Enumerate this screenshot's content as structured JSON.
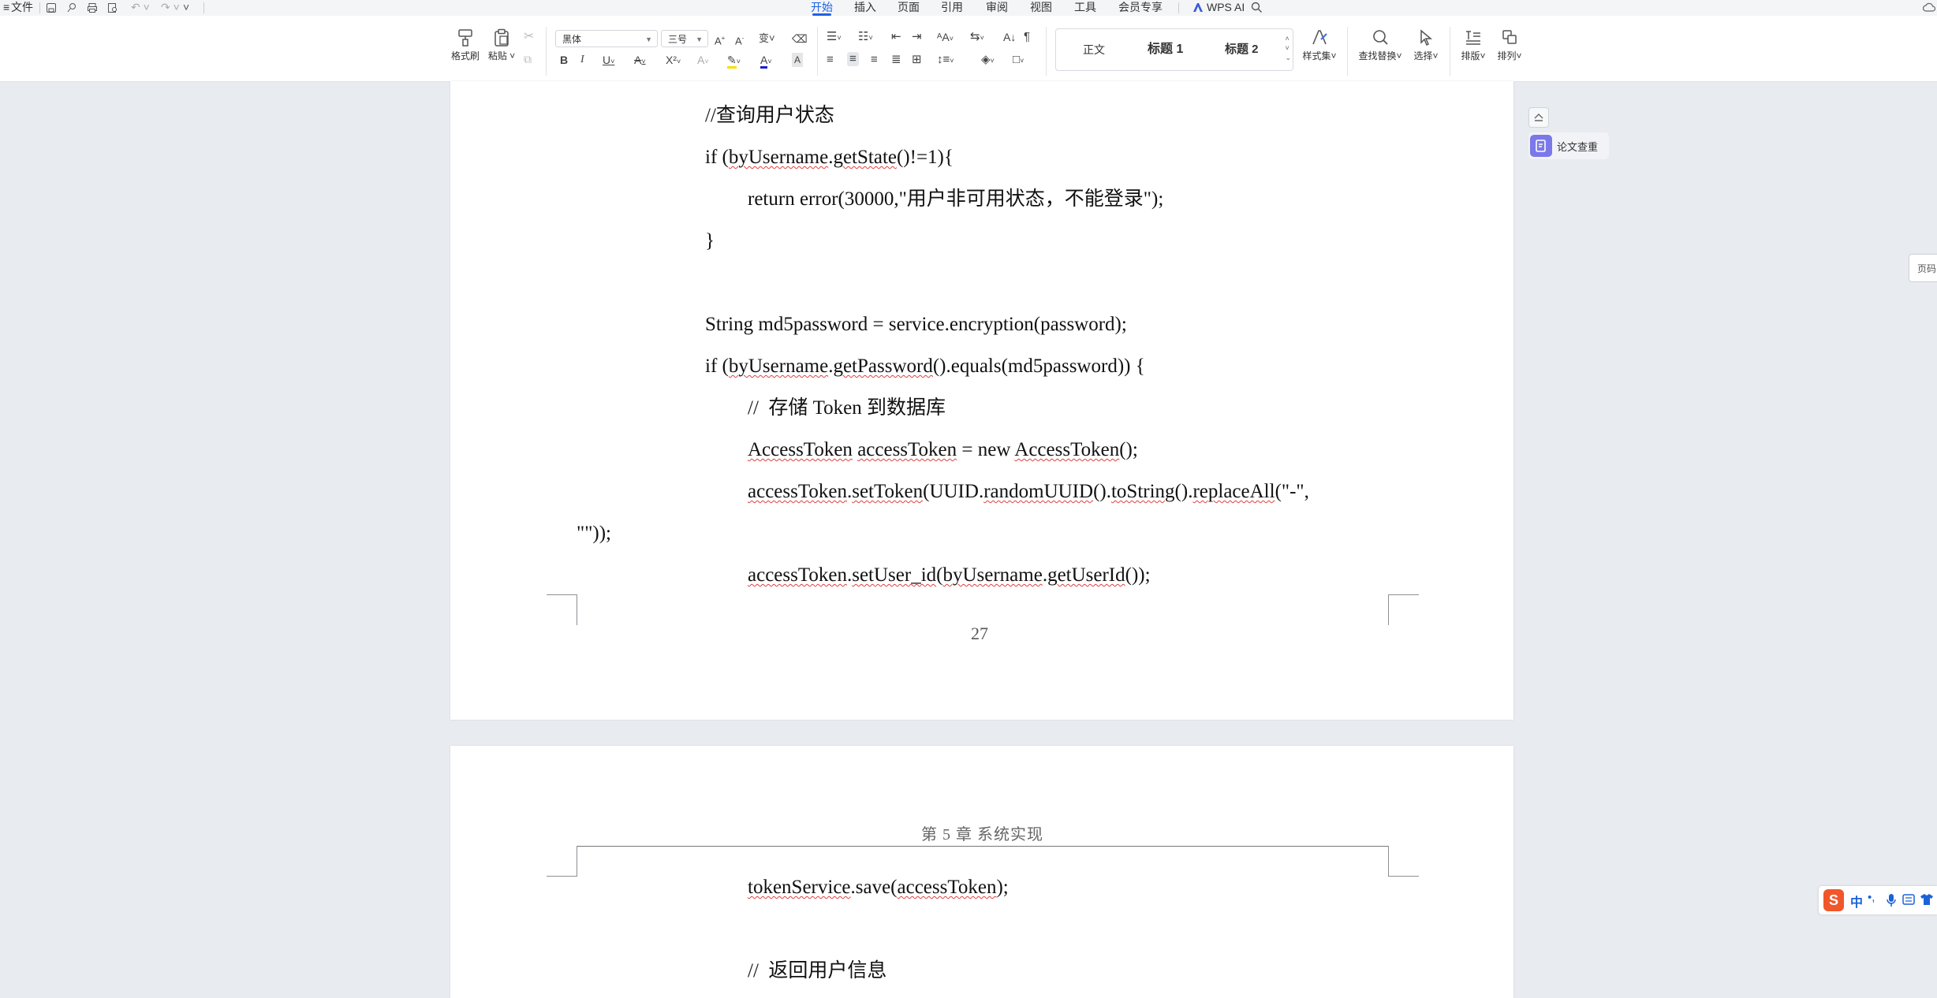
{
  "titlebar": {
    "file_label": "文件",
    "tabs": [
      "开始",
      "插入",
      "页面",
      "引用",
      "审阅",
      "视图",
      "工具",
      "会员专享"
    ],
    "active_tab": "开始",
    "wps_ai_label": "WPS AI"
  },
  "ribbon": {
    "format_painter_label": "格式刷",
    "paste_label": "粘贴",
    "font_name": "黑体",
    "font_size": "三号",
    "styles": [
      "正文",
      "标题 1",
      "标题 2"
    ],
    "style_set_label": "样式集",
    "find_replace_label": "查找替换",
    "select_label": "选择",
    "layout_label": "排版",
    "arrange_label": "排列"
  },
  "side": {
    "check_label": "论文查重",
    "page_tab_label": "页码"
  },
  "page1": {
    "lines": [
      "//查询用户状态",
      "if (byUsername.getState()!=1){",
      "return error(30000,\"用户非可用状态，不能登录\");",
      "}",
      "String md5password = service.encryption(password);",
      "if (byUsername.getPassword().equals(md5password)) {",
      "//  存储 Token 到数据库",
      "AccessToken accessToken = new AccessToken();",
      "accessToken.setToken(UUID.randomUUID().toString().replaceAll(\"-\",",
      "\"\"));",
      "accessToken.setUser_id(byUsername.getUserId());"
    ],
    "page_number": "27"
  },
  "page2": {
    "header": "第 5 章   系统实现",
    "lines": [
      "tokenService.save(accessToken);",
      "//  返回用户信息"
    ]
  },
  "ime": {
    "lang": "中"
  },
  "colors": {
    "accent": "#1f61e6",
    "background": "#e8ebef",
    "spell_underline": "#e04040"
  }
}
